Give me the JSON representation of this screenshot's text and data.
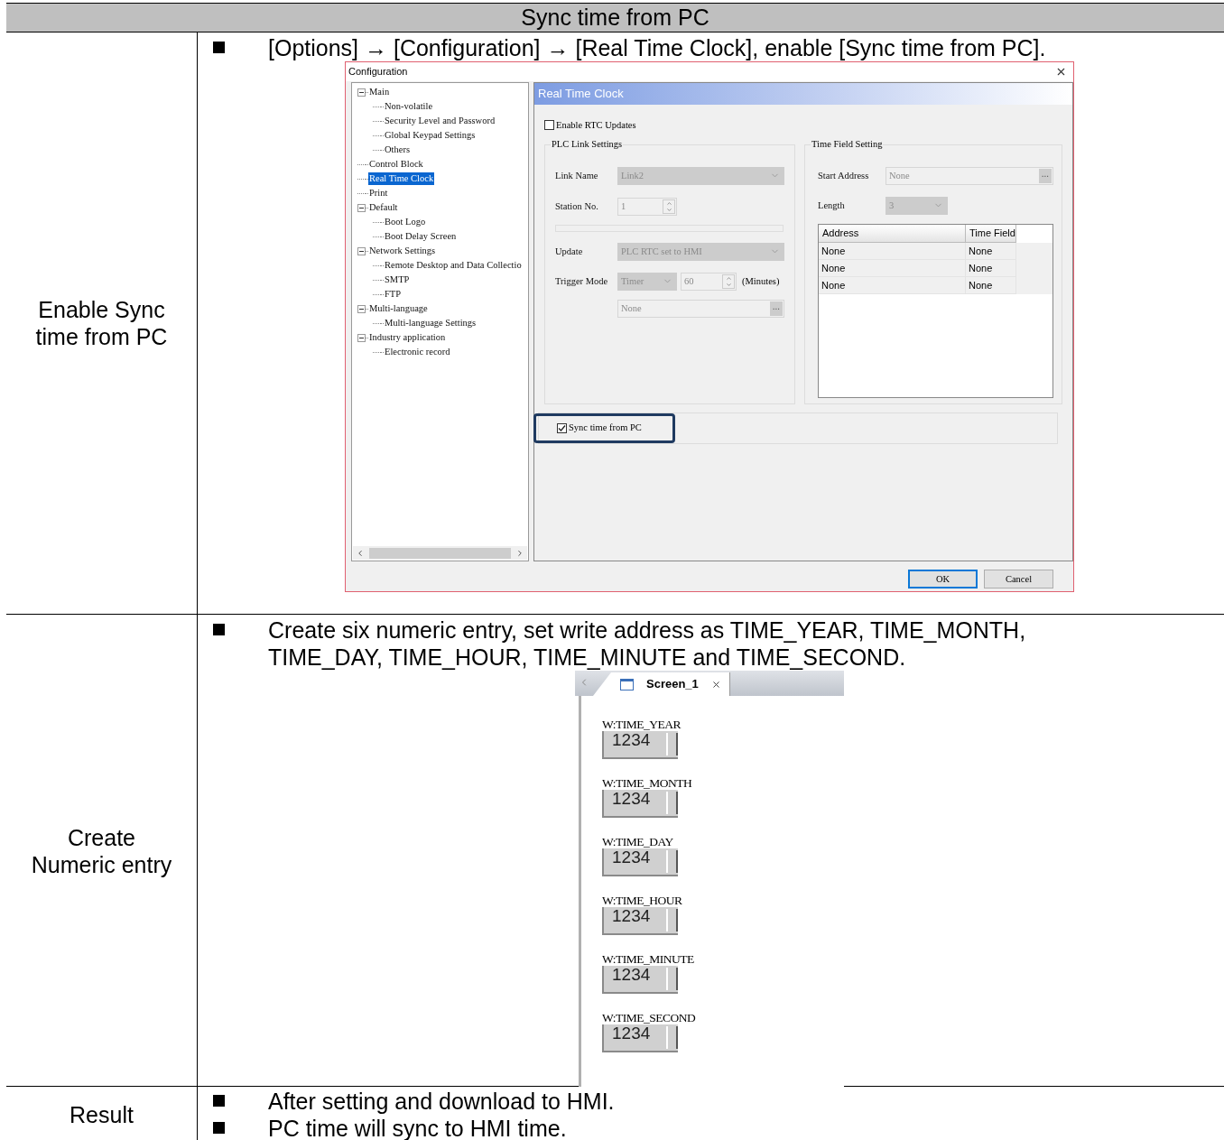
{
  "header": "Sync time from PC",
  "config_step": {
    "label": "Enable Sync time from PC",
    "bullets": [
      "[Options] → [Configuration] → [Real Time Clock], enable [Sync time from PC]."
    ],
    "dialog": {
      "title": "Configuration",
      "tree": [
        {
          "label": "Main",
          "expanded": true,
          "selected": false,
          "children": [
            {
              "label": "Non-volatile",
              "selected": false
            },
            {
              "label": "Security Level and Password",
              "selected": false
            },
            {
              "label": "Global Keypad Settings",
              "selected": false
            },
            {
              "label": "Others",
              "selected": false
            }
          ]
        },
        {
          "label": "Control Block",
          "selected": false
        },
        {
          "label": "Real Time Clock",
          "selected": true
        },
        {
          "label": "Print",
          "selected": false
        },
        {
          "label": "Default",
          "expanded": true,
          "selected": false,
          "children": [
            {
              "label": "Boot Logo",
              "selected": false
            },
            {
              "label": "Boot Delay Screen",
              "selected": false
            }
          ]
        },
        {
          "label": "Network Settings",
          "expanded": true,
          "selected": false,
          "children": [
            {
              "label": "Remote Desktop and Data Collectio",
              "selected": false
            },
            {
              "label": "SMTP",
              "selected": false
            },
            {
              "label": "FTP",
              "selected": false
            }
          ]
        },
        {
          "label": "Multi-language",
          "expanded": true,
          "selected": false,
          "children": [
            {
              "label": "Multi-language Settings",
              "selected": false
            }
          ]
        },
        {
          "label": "Industry application",
          "expanded": true,
          "selected": false,
          "children": [
            {
              "label": "Electronic record",
              "selected": false
            }
          ]
        }
      ],
      "panel_title": "Real Time Clock",
      "enable_rtc_updates": {
        "label": "Enable RTC Updates",
        "checked": false
      },
      "plc_link_settings": {
        "title": "PLC Link Settings",
        "disabled": true,
        "link_name": {
          "label": "Link Name",
          "value": "Link2"
        },
        "station_no": {
          "label": "Station No.",
          "value": "1"
        },
        "update": {
          "label": "Update",
          "value": "PLC RTC set to HMI"
        },
        "trigger_mode": {
          "label": "Trigger Mode",
          "value": "Timer",
          "interval": "60",
          "unit": "(Minutes)"
        },
        "address": {
          "value": "None",
          "browse": "..."
        }
      },
      "time_field_setting": {
        "title": "Time Field Setting",
        "disabled": true,
        "start_address": {
          "label": "Start Address",
          "value": "None",
          "browse": "..."
        },
        "length": {
          "label": "Length",
          "value": "3"
        },
        "columns": [
          "Address",
          "Time Field"
        ],
        "rows": [
          [
            "None",
            "None"
          ],
          [
            "None",
            "None"
          ],
          [
            "None",
            "None"
          ]
        ]
      },
      "sync_time_from_pc": {
        "label": "Sync time from PC",
        "checked": true
      },
      "buttons": [
        {
          "label": "OK",
          "default": true
        },
        {
          "label": "Cancel",
          "default": false
        }
      ]
    }
  },
  "numeric_step": {
    "label": "Create Numeric entry",
    "bullets": [
      "Create six numeric entry, set write address as TIME_YEAR, TIME_MONTH, TIME_DAY, TIME_HOUR, TIME_MINUTE and TIME_SECOND."
    ],
    "screen": {
      "tab": "Screen_1",
      "entries": [
        {
          "address": "W:TIME_YEAR",
          "value": "1234"
        },
        {
          "address": "W:TIME_MONTH",
          "value": "1234"
        },
        {
          "address": "W:TIME_DAY",
          "value": "1234"
        },
        {
          "address": "W:TIME_HOUR",
          "value": "1234"
        },
        {
          "address": "W:TIME_MINUTE",
          "value": "1234"
        },
        {
          "address": "W:TIME_SECOND",
          "value": "1234"
        }
      ]
    }
  },
  "result_step": {
    "label": "Result",
    "bullets": [
      "After setting and download to HMI.",
      "PC time will sync to HMI time."
    ]
  }
}
